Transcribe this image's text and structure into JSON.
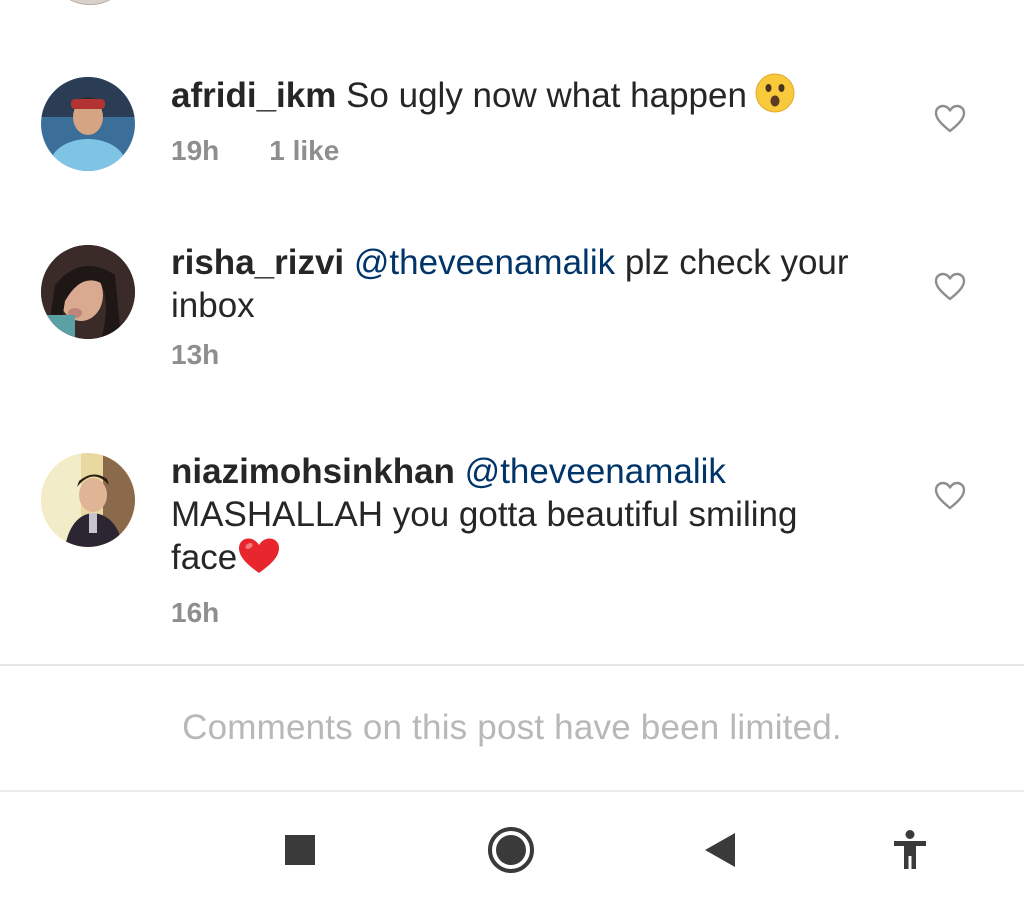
{
  "comments": [
    {
      "username": "afridi_ikm",
      "text": " So ugly now what happen",
      "mention": "",
      "text_after": "",
      "emoji": "astonished-face-emoji",
      "time": "19h",
      "likes": "1 like"
    },
    {
      "username": "risha_rizvi",
      "mention": "@theveenamalik",
      "text": " plz check your inbox",
      "time": "13h",
      "likes": ""
    },
    {
      "username": "niazimohsinkhan",
      "mention": "@theveenamalik",
      "text": " MASHALLAH you gotta beautiful smiling face",
      "emoji": "red-heart-emoji",
      "time": "16h",
      "likes": ""
    }
  ],
  "footer": {
    "limited_text": "Comments on this post have been limited."
  },
  "navbar": {
    "icons": [
      "stop-square-icon",
      "home-circle-icon",
      "back-triangle-icon",
      "accessibility-icon"
    ]
  },
  "colors": {
    "mention": "#003569",
    "secondary_text": "#8e8e8e",
    "heart_outline": "#8e8e8e",
    "nav_icon": "#3a3a3a"
  }
}
